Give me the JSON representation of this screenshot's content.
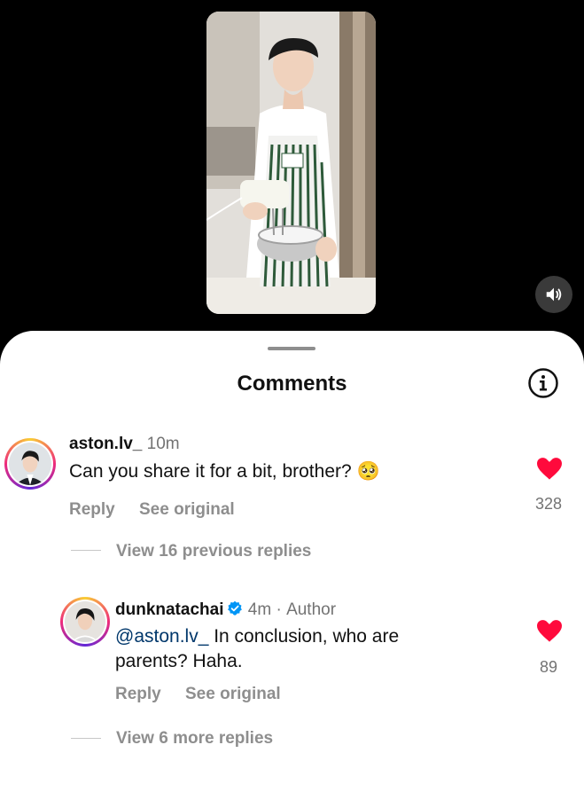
{
  "sheet": {
    "title": "Comments"
  },
  "comments": [
    {
      "username": "aston.lv_",
      "time": "10m",
      "text": "Can you share it for a bit, brother?",
      "emoji": "🥺",
      "reply_label": "Reply",
      "see_original_label": "See original",
      "likes": "328",
      "view_replies_label": "View 16 previous replies"
    },
    {
      "username": "dunknatachai",
      "verified": true,
      "time": "4m",
      "separator": "·",
      "author_badge": "Author",
      "mention": "@aston.lv_",
      "text_line1": " In conclusion, who are",
      "text_line2": "parents? Haha.",
      "reply_label": "Reply",
      "see_original_label": "See original",
      "likes": "89",
      "view_replies_label": "View 6 more replies"
    }
  ],
  "colors": {
    "like": "#ff0a3c",
    "mention": "#00376b",
    "secondary": "#8e8e8e"
  },
  "icons": {
    "mute": "speaker-icon",
    "info": "info-icon",
    "like": "heart-icon",
    "verified": "verified-badge-icon"
  }
}
